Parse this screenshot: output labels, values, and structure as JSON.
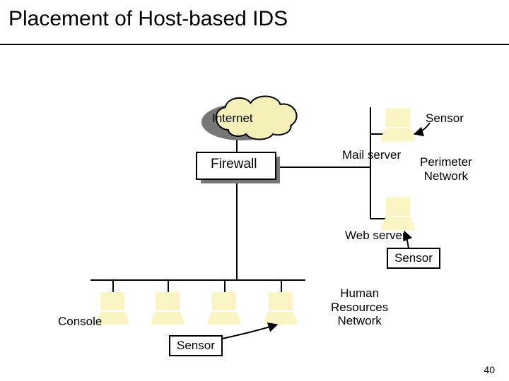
{
  "slide": {
    "title": "Placement of Host-based IDS",
    "page_number": "40"
  },
  "labels": {
    "internet": "Internet",
    "firewall": "Firewall",
    "mail_server": "Mail server",
    "web_server": "Web server",
    "console": "Console",
    "hr_network": "Human\nResources\nNetwork",
    "perimeter_network": "Perimeter\nNetwork",
    "sensor_top": "Sensor",
    "sensor_mid": "Sensor",
    "sensor_bottom": "Sensor"
  }
}
